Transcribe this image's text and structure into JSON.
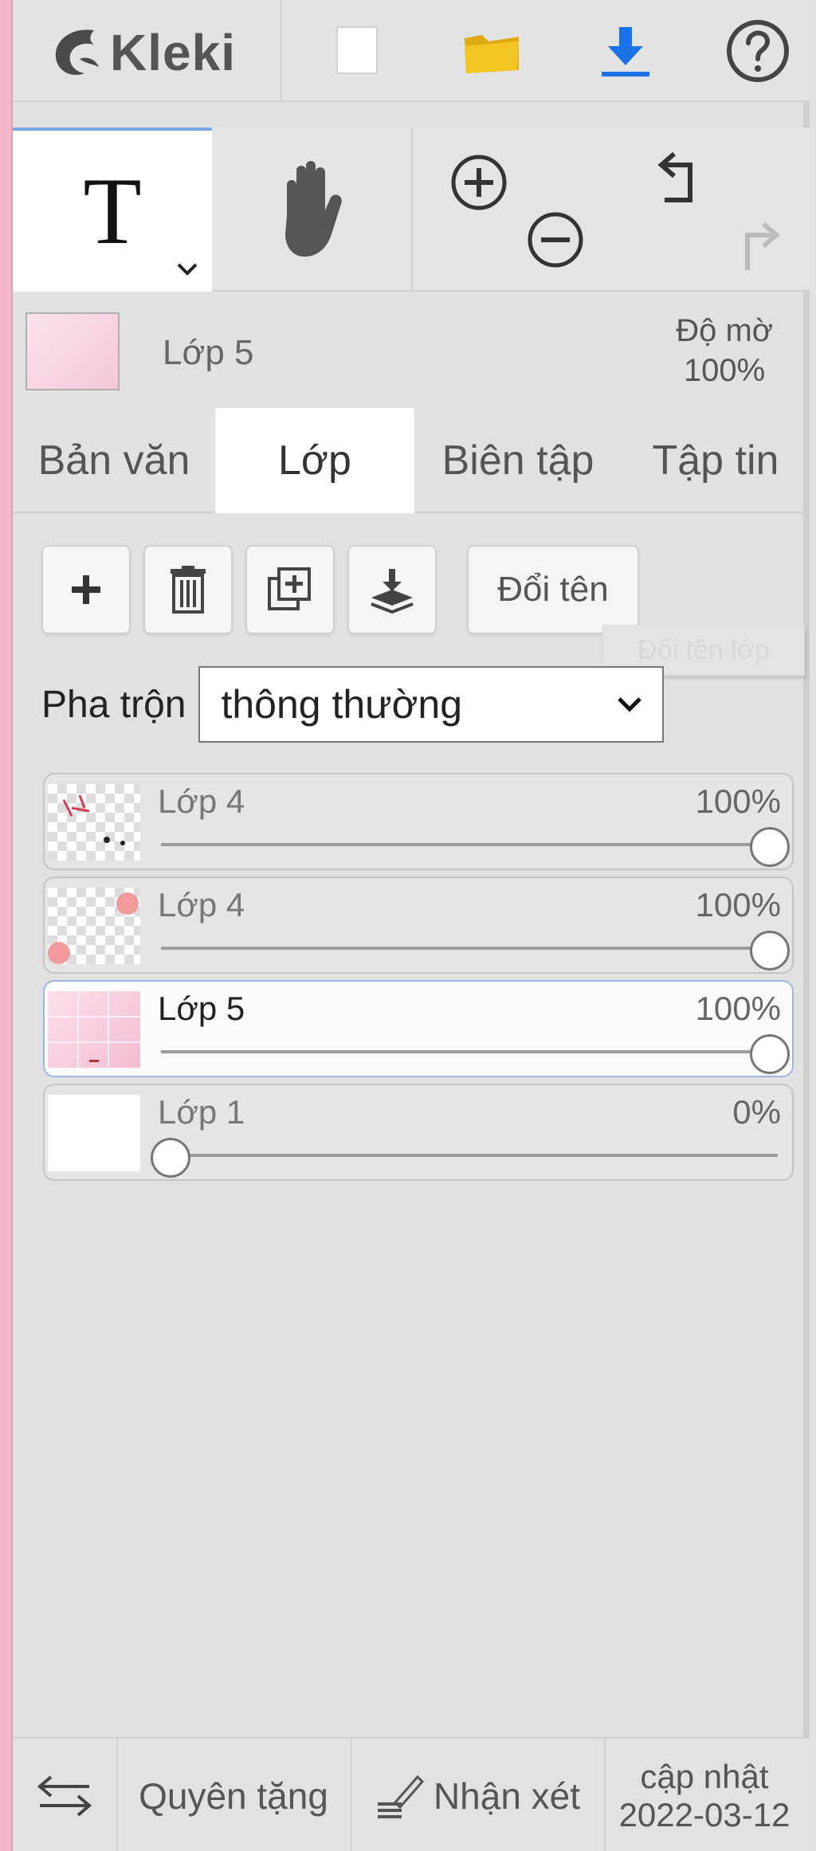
{
  "app": {
    "name": "Kleki"
  },
  "toolbar": {
    "icons": [
      "new-image-icon",
      "open-folder-icon",
      "download-icon",
      "help-icon"
    ],
    "colors": {
      "folder": "#f1c21b",
      "download": "#1a73e8"
    }
  },
  "tools": {
    "text_glyph": "T",
    "hand_icon": "hand-icon",
    "zoom_in_icon": "zoom-in-icon",
    "zoom_out_icon": "zoom-out-icon",
    "undo_icon": "undo-icon",
    "redo_icon": "redo-icon"
  },
  "current_layer": {
    "name": "Lớp 5",
    "opacity_label": "Độ mờ",
    "opacity": "100%"
  },
  "tabs": [
    {
      "label": "Bản văn",
      "active": false
    },
    {
      "label": "Lớp",
      "active": true
    },
    {
      "label": "Biên tập",
      "active": false
    },
    {
      "label": "Tập tin",
      "active": false
    }
  ],
  "layer_actions": {
    "rename_label": "Đổi tên",
    "tooltip": "Đổi tên lớp"
  },
  "blend": {
    "label": "Pha trộn",
    "value": "thông thường"
  },
  "layers": [
    {
      "name": "Lớp 4",
      "opacity": "100%",
      "opacity_value": 1.0,
      "selected": false
    },
    {
      "name": "Lớp 4",
      "opacity": "100%",
      "opacity_value": 1.0,
      "selected": false
    },
    {
      "name": "Lớp 5",
      "opacity": "100%",
      "opacity_value": 1.0,
      "selected": true
    },
    {
      "name": "Lớp 1",
      "opacity": "0%",
      "opacity_value": 0.0,
      "selected": false
    }
  ],
  "footer": {
    "donate": "Quyên tặng",
    "feedback": "Nhận xét",
    "update_label": "cập nhật",
    "update_date": "2022-03-12"
  }
}
